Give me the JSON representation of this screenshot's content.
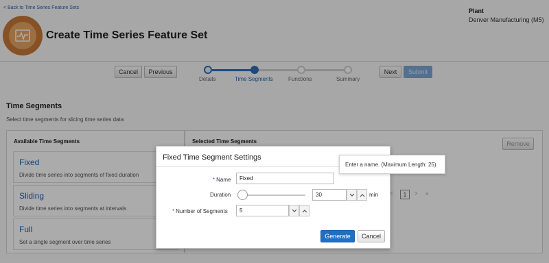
{
  "header": {
    "back_link": "< Back to Time Series Feature Sets",
    "title": "Create Time Series Feature Set",
    "plant_label": "Plant",
    "plant_value": "Denver Manufacturing (M5)"
  },
  "train": {
    "cancel": "Cancel",
    "previous": "Previous",
    "next": "Next",
    "submit": "Submit",
    "steps": [
      "Details",
      "Time Segments",
      "Functions",
      "Summary"
    ],
    "current_step": "Time Segments"
  },
  "section": {
    "title": "Time Segments",
    "description": "Select time segments for slicing time series data"
  },
  "available": {
    "heading": "Available Time Segments",
    "items": [
      {
        "name": "Fixed",
        "description": "Divide time series into segments of fixed duration"
      },
      {
        "name": "Sliding",
        "description": "Divide time series into segments at intervals"
      },
      {
        "name": "Full",
        "description": "Set a single segment over time series"
      }
    ]
  },
  "selected": {
    "heading": "Selected Time Segments",
    "remove": "Remove",
    "pager": {
      "prev": "<",
      "page": "1",
      "next": ">",
      "last": "»"
    }
  },
  "dialog": {
    "title": "Fixed Time Segment Settings",
    "name_label": "Name",
    "name_value": "Fixed",
    "duration_label": "Duration",
    "duration_value": "30",
    "duration_unit": "min",
    "segments_label": "Number of Segments",
    "segments_value": "5",
    "generate": "Generate",
    "cancel": "Cancel"
  },
  "tooltip": "Enter a name. (Maximum Length: 25)",
  "colors": {
    "accent": "#1f6fc5",
    "link": "#1f62b3",
    "logo": "#c97a3a"
  }
}
